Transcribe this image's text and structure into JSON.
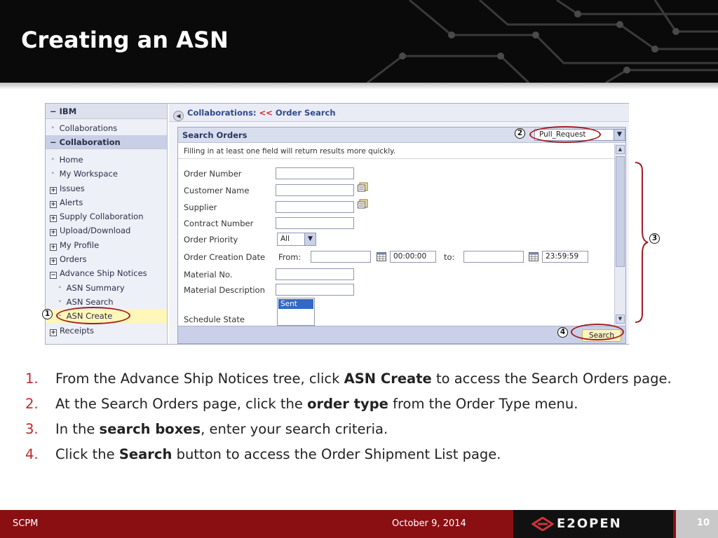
{
  "slide": {
    "title": "Creating an ASN"
  },
  "nav": {
    "items": [
      {
        "label": "IBM",
        "kind": "section-expanded"
      },
      {
        "label": "Collaborations",
        "kind": "link"
      },
      {
        "label": "Collaboration",
        "kind": "section-expanded"
      },
      {
        "label": "Home",
        "kind": "link"
      },
      {
        "label": "My Workspace",
        "kind": "link"
      },
      {
        "label": "Issues",
        "kind": "collapsed"
      },
      {
        "label": "Alerts",
        "kind": "collapsed"
      },
      {
        "label": "Supply Collaboration",
        "kind": "collapsed"
      },
      {
        "label": "Upload/Download",
        "kind": "collapsed"
      },
      {
        "label": "My Profile",
        "kind": "collapsed"
      },
      {
        "label": "Orders",
        "kind": "collapsed"
      },
      {
        "label": "Advance Ship Notices",
        "kind": "expanded"
      },
      {
        "label": "ASN Summary",
        "kind": "sub-link"
      },
      {
        "label": "ASN Search",
        "kind": "sub-link"
      },
      {
        "label": "ASN Create",
        "kind": "sub-link-selected"
      },
      {
        "label": "Receipts",
        "kind": "collapsed"
      }
    ]
  },
  "breadcrumb": {
    "prefix": "Collaborations:",
    "separator": "<<",
    "current": "Order Search"
  },
  "search_panel": {
    "title": "Search Orders",
    "order_type_value": "Pull_Request",
    "hint": "Filling in at least one field will return results more quickly.",
    "labels": {
      "order_number": "Order Number",
      "customer_name": "Customer Name",
      "supplier": "Supplier",
      "contract_number": "Contract Number",
      "order_priority": "Order Priority",
      "order_creation_date": "Order Creation Date",
      "from": "From:",
      "to": "to:",
      "material_no": "Material No.",
      "material_description": "Material Description",
      "schedule_state": "Schedule State"
    },
    "values": {
      "order_priority": "All",
      "from_time": "00:00:00",
      "to_time": "23:59:59",
      "schedule_state_option": "Sent"
    },
    "search_button": "Search"
  },
  "callouts": {
    "one": "1",
    "two": "2",
    "three": "3",
    "four": "4"
  },
  "steps": [
    {
      "num": "1.",
      "before": "From the Advance Ship Notices tree, click ",
      "bold": "ASN Create",
      "after": " to access the Search Orders page."
    },
    {
      "num": "2.",
      "before": "At the Search Orders page, click the ",
      "bold": "order type",
      "after": " from the Order Type menu."
    },
    {
      "num": "3.",
      "before": "In the ",
      "bold": "search boxes",
      "after": ", enter your search criteria."
    },
    {
      "num": "4.",
      "before": "Click the ",
      "bold": "Search",
      "after": " button to access the Order Shipment List page."
    }
  ],
  "footer": {
    "left": "SCPM",
    "date": "October 9, 2014",
    "brand": "E2OPEN",
    "page_number": "10"
  },
  "colors": {
    "accent_red": "#8a0f12",
    "callout_ring": "#a11d24",
    "banner": "#0a0a0a"
  }
}
